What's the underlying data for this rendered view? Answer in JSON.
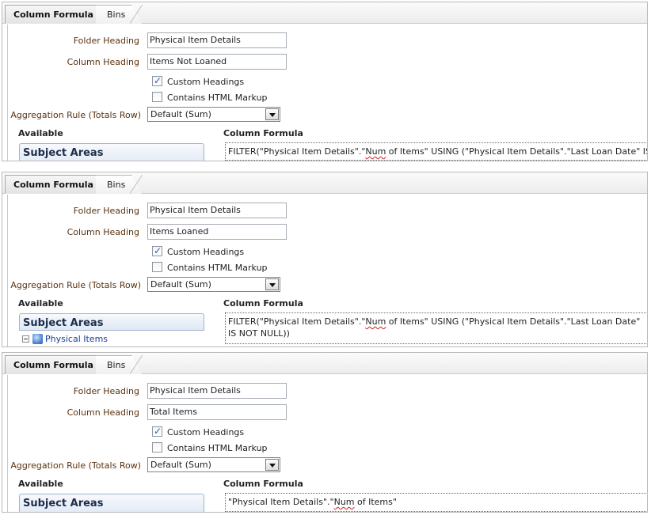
{
  "tabs": {
    "column_formula": "Column Formula",
    "bins": "Bins"
  },
  "labels": {
    "folder_heading": "Folder Heading",
    "column_heading": "Column Heading",
    "custom_headings": "Custom Headings",
    "contains_html": "Contains HTML Markup",
    "aggregation_rule": "Aggregation Rule (Totals Row)",
    "available": "Available",
    "column_formula": "Column Formula",
    "subject_areas": "Subject Areas"
  },
  "panels": [
    {
      "folder_heading": "Physical Item Details",
      "column_heading": "Items Not Loaned",
      "custom_headings_checked": true,
      "contains_html_checked": false,
      "aggregation": "Default (Sum)",
      "tree_item": "",
      "formula": {
        "a": "FILTER(\"Physical Item Details\".\"",
        "sq": "Num",
        "b": " of Items\" USING (\"Physical Item Details\".\"Last Loan Date\" IS NULL))"
      }
    },
    {
      "folder_heading": "Physical Item Details",
      "column_heading": "Items Loaned",
      "custom_headings_checked": true,
      "contains_html_checked": false,
      "aggregation": "Default (Sum)",
      "tree_item": "Physical Items",
      "formula": {
        "a": "FILTER(\"Physical Item Details\".\"",
        "sq": "Num",
        "b": " of Items\" USING (\"Physical Item Details\".\"Last Loan Date\" IS NOT NULL))"
      }
    },
    {
      "folder_heading": "Physical Item Details",
      "column_heading": "Total Items",
      "custom_headings_checked": true,
      "contains_html_checked": false,
      "aggregation": "Default (Sum)",
      "tree_item": "",
      "formula": {
        "a": "\"Physical Item Details\".\"",
        "sq": "Num",
        "b": " of Items\""
      }
    }
  ]
}
